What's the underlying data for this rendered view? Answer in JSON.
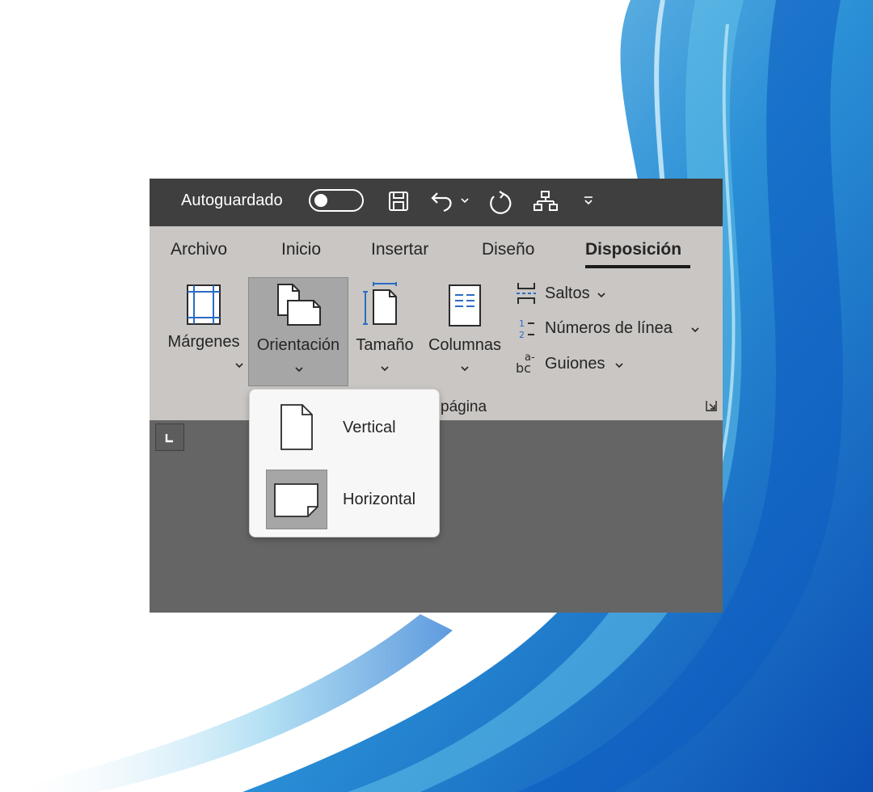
{
  "title_bar": {
    "autosave_label": "Autoguardado",
    "icons": [
      "toggle-off-icon",
      "save-icon",
      "undo-icon",
      "chevron-down-icon",
      "redo-icon",
      "org-chart-icon",
      "customize-toolbar-icon"
    ]
  },
  "ribbon": {
    "tabs": [
      {
        "label": "Archivo"
      },
      {
        "label": "Inicio"
      },
      {
        "label": "Insertar"
      },
      {
        "label": "Diseño"
      },
      {
        "label": "Disposición",
        "active": true
      }
    ],
    "commands": [
      {
        "label": "Márgenes",
        "icon": "margins-icon"
      },
      {
        "label": "Orientación",
        "icon": "orientation-icon",
        "pressed": true
      },
      {
        "label": "Tamaño",
        "icon": "size-icon"
      },
      {
        "label": "Columnas",
        "icon": "columns-icon"
      }
    ],
    "small_commands": [
      {
        "label": "Saltos",
        "icon": "breaks-icon"
      },
      {
        "label": "Números de línea",
        "icon": "line-numbers-icon"
      },
      {
        "label": "Guiones",
        "icon": "hyphenation-icon"
      }
    ],
    "group_label": "página"
  },
  "orientation_menu": {
    "items": [
      {
        "label": "Vertical",
        "icon": "portrait-page-icon",
        "selected": false
      },
      {
        "label": "Horizontal",
        "icon": "landscape-page-icon",
        "selected": true
      }
    ]
  },
  "colors": {
    "title_bar": "#3f3f3f",
    "ribbon": "#c9c6c3",
    "document_area": "#656565",
    "pressed_button": "#a6a6a6",
    "menu_background": "#f7f7f7",
    "accent_blue": "#2b6cc4"
  }
}
